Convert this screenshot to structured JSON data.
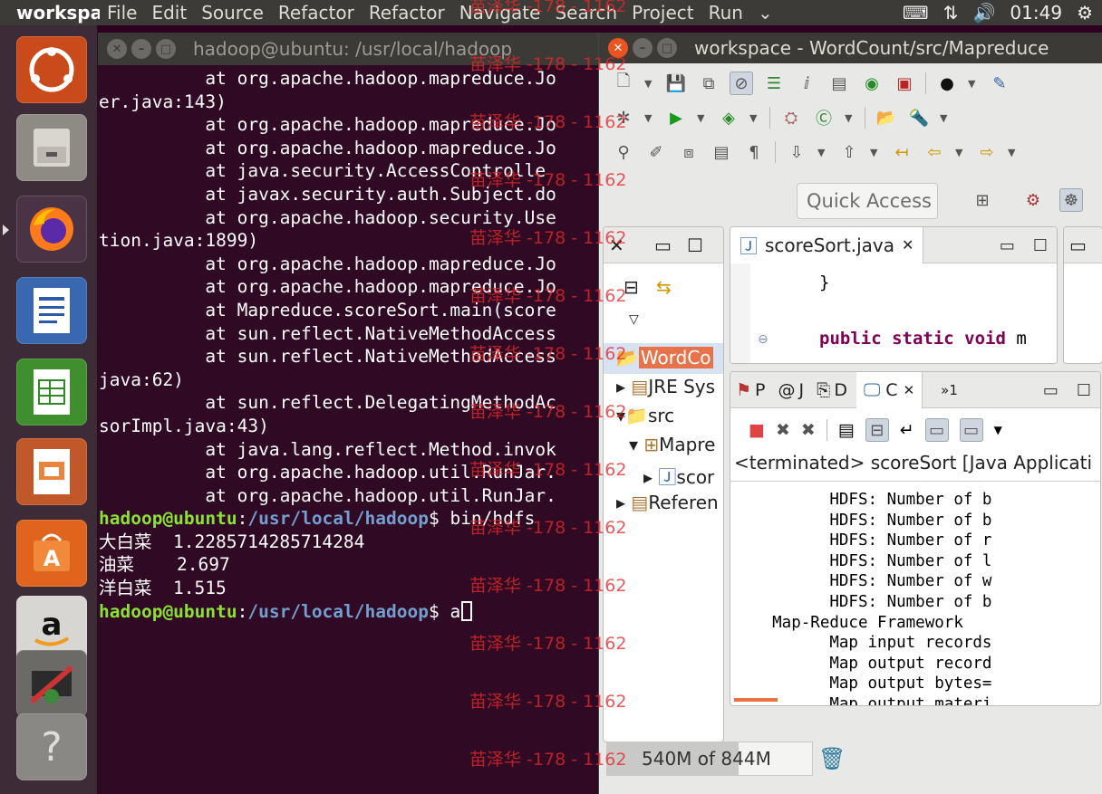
{
  "top_panel": {
    "app_name": "workspace",
    "menu": [
      "File",
      "Edit",
      "Source",
      "Refactor",
      "Refactor",
      "Navigate",
      "Search",
      "Project",
      "Run"
    ],
    "overflow": "⌄",
    "time": "01:49"
  },
  "terminal": {
    "title": "hadoop@ubuntu: /usr/local/hadoop",
    "lines": [
      "          at org.apache.hadoop.mapreduce.Jo",
      "er.java:143)",
      "          at org.apache.hadoop.mapreduce.Jo",
      "          at org.apache.hadoop.mapreduce.Jo",
      "          at java.security.AccessControlle",
      "          at javax.security.auth.Subject.do",
      "          at org.apache.hadoop.security.Use",
      "tion.java:1899)",
      "          at org.apache.hadoop.mapreduce.Jo",
      "          at org.apache.hadoop.mapreduce.Jo",
      "          at Mapreduce.scoreSort.main(score",
      "          at sun.reflect.NativeMethodAccess",
      "          at sun.reflect.NativeMethodAccess",
      "java:62)",
      "          at sun.reflect.DelegatingMethodAc",
      "sorImpl.java:43)",
      "          at java.lang.reflect.Method.invok",
      "          at org.apache.hadoop.util.RunJar.",
      "          at org.apache.hadoop.util.RunJar."
    ],
    "prompt1": {
      "user": "hadoop@ubuntu",
      "sep": ":",
      "path": "/usr/local/hadoop",
      "dollar": "$ ",
      "command": "bin/hdfs"
    },
    "results": [
      {
        "name": "大白菜",
        "value": "1.2285714285714284"
      },
      {
        "name": "油菜",
        "value": "2.697"
      },
      {
        "name": "洋白菜",
        "value": "1.515"
      }
    ],
    "prompt2": {
      "user": "hadoop@ubuntu",
      "sep": ":",
      "path": "/usr/local/hadoop",
      "dollar": "$ ",
      "command": "a"
    }
  },
  "eclipse": {
    "title": "workspace - WordCount/src/Mapreduce",
    "quick_access": "Quick Access",
    "editor": {
      "tab_label": "scoreSort.java",
      "line1": "}",
      "line2_kw": "public static void",
      "line2_rest": " m"
    },
    "package_explorer": {
      "items": [
        "WordCo",
        "JRE Sys",
        "src",
        "Mapre",
        "scor",
        "Referen"
      ]
    },
    "console": {
      "tabs": [
        "P",
        "J",
        "D",
        "C"
      ],
      "overflow": "»1",
      "header": "<terminated> scoreSort [Java Applicati",
      "lines": [
        "          HDFS: Number of b",
        "          HDFS: Number of b",
        "          HDFS: Number of r",
        "          HDFS: Number of l",
        "          HDFS: Number of w",
        "          HDFS: Number of b",
        "    Map-Reduce Framework",
        "          Map input records",
        "          Map output record",
        "          Map output bytes=",
        "          Map output materi"
      ]
    },
    "heap": {
      "label": "540M of 844M",
      "fraction": 0.64
    }
  },
  "watermark": "苗泽华 -178 - 1162",
  "colors": {
    "terminal_bg": "#300a24",
    "prompt_user": "#8ae234",
    "prompt_path": "#729fcf",
    "ubuntu_orange": "#e95420"
  }
}
